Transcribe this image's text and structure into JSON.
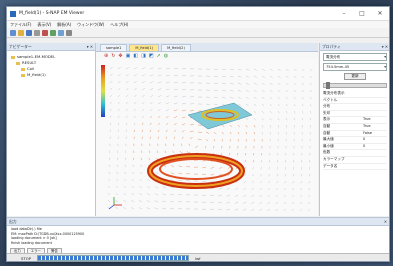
{
  "window": {
    "title": "M_field(1) - S-NAP EM Viewer"
  },
  "menu": [
    "ファイル(F)",
    "表示(V)",
    "解析(A)",
    "ウィンドウ(W)",
    "ヘルプ(H)"
  ],
  "left_panel": {
    "title": "ナビゲーター",
    "tree": [
      "sample1-EM-MODEL",
      "RESULT",
      "Coil",
      "M_field(1)"
    ]
  },
  "tabs": [
    "sample1",
    "M_field(1)",
    "M_field(2)"
  ],
  "right_panel": {
    "title": "プロパティ",
    "select1": "電流分布",
    "select2": "754.5mm-45",
    "button": "更新",
    "props": [
      {
        "k": "電流分布表示",
        "v": ""
      },
      {
        "k": "ベクトル",
        "v": ""
      },
      {
        "k": "分布",
        "v": ""
      },
      {
        "k": "矢印",
        "v": ""
      },
      {
        "k": "表示",
        "v": "True"
      },
      {
        "k": "自動",
        "v": "True"
      },
      {
        "k": "自動",
        "v": "False"
      },
      {
        "k": "最大値",
        "v": "0"
      },
      {
        "k": "最小値",
        "v": "0"
      },
      {
        "k": "色数",
        "v": ""
      },
      {
        "k": "カラーマップ",
        "v": ""
      },
      {
        "k": "データ名",
        "v": ""
      }
    ]
  },
  "log": {
    "title": "出力",
    "lines": [
      "load dataDir(.) file",
      "EM: maxPath D:\\TGDB-xx\\Xxx-0000125900",
      "loading document > 0 [ok]",
      "finish loading document"
    ],
    "tabs": [
      "出力",
      "エラー",
      "警告"
    ]
  },
  "status": {
    "left": "STOP",
    "progress": 1.0,
    "right": "lwf"
  }
}
